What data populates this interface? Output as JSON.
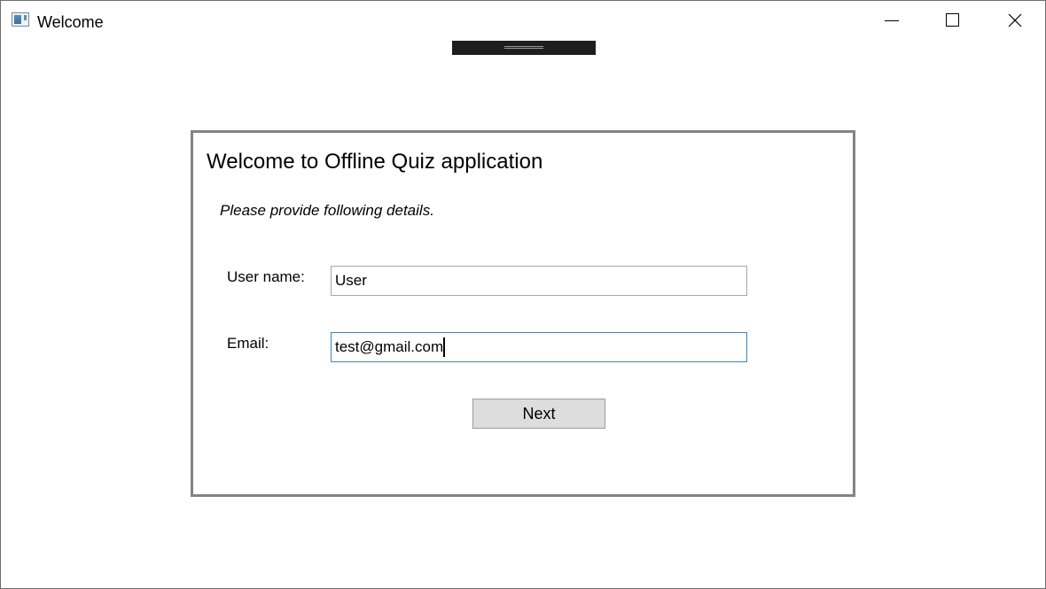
{
  "window": {
    "title": "Welcome",
    "icon": "window-app-icon",
    "controls": {
      "minimize_icon": "minimize-icon",
      "maximize_icon": "maximize-icon",
      "close_icon": "close-icon"
    }
  },
  "form": {
    "heading": "Welcome to Offline Quiz application",
    "subheading": "Please provide following details.",
    "username": {
      "label": "User name:",
      "value": "User"
    },
    "email": {
      "label": "Email:",
      "value": "test@gmail.com",
      "focused": true
    },
    "next_label": "Next"
  },
  "colors": {
    "panel_border": "#838383",
    "focus_border": "#3c85c6",
    "button_background": "#dddddd"
  }
}
